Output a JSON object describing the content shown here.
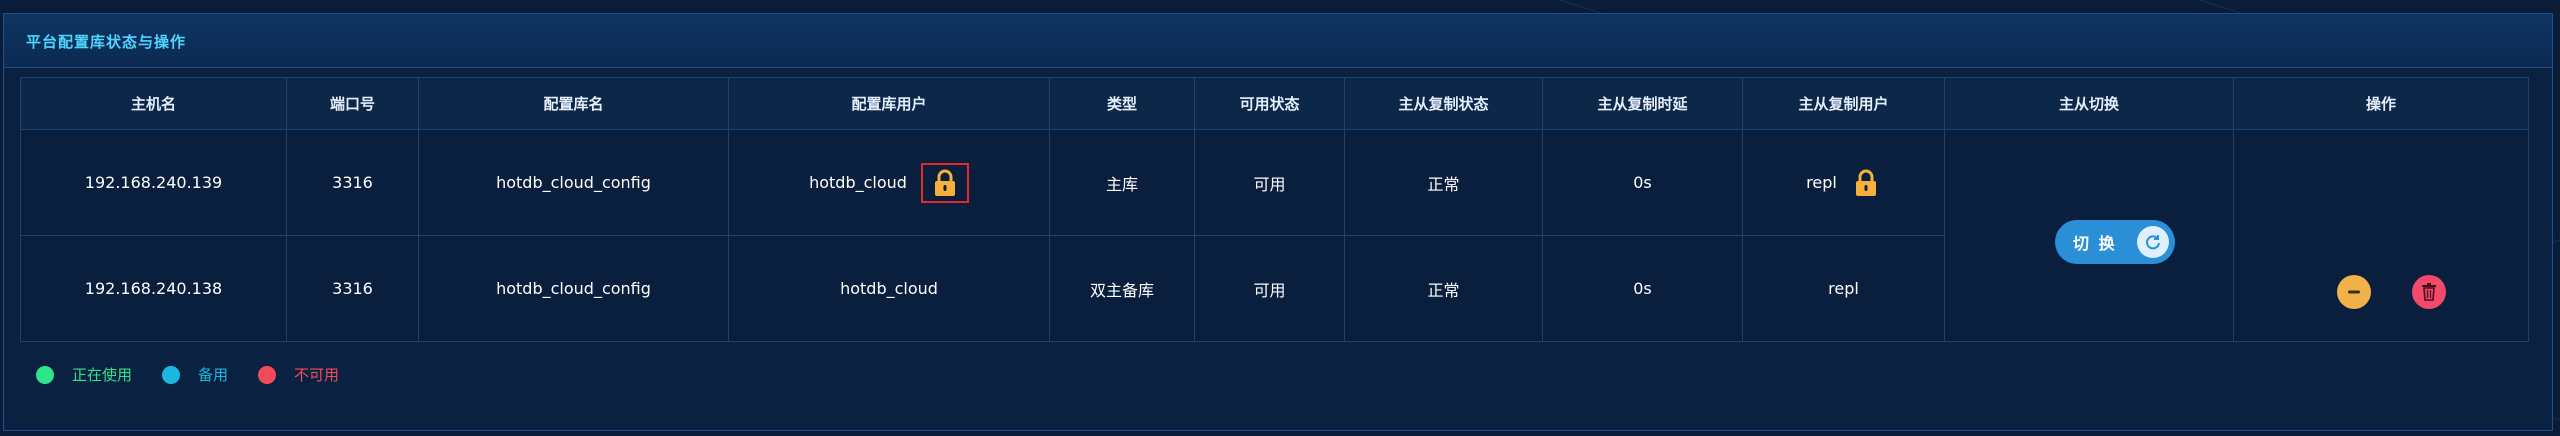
{
  "panel": {
    "title": "平台配置库状态与操作"
  },
  "table": {
    "headers": [
      "主机名",
      "端口号",
      "配置库名",
      "配置库用户",
      "类型",
      "可用状态",
      "主从复制状态",
      "主从复制时延",
      "主从复制用户",
      "主从切换",
      "操作"
    ],
    "rows": [
      {
        "host": "192.168.240.139",
        "port": "3316",
        "db": "hotdb_cloud_config",
        "user": "hotdb_cloud",
        "type": "主库",
        "status": "可用",
        "repl_status": "正常",
        "repl_delay": "0s",
        "repl_user": "repl"
      },
      {
        "host": "192.168.240.138",
        "port": "3316",
        "db": "hotdb_cloud_config",
        "user": "hotdb_cloud",
        "type": "双主备库",
        "status": "可用",
        "repl_status": "正常",
        "repl_delay": "0s",
        "repl_user": "repl"
      }
    ]
  },
  "switch": {
    "label": "切 换",
    "icon": "refresh-icon"
  },
  "actions": {
    "minus_icon": "minus-icon",
    "delete_icon": "trash-icon"
  },
  "legend": [
    {
      "label": "正在使用",
      "color": "#2ee58a"
    },
    {
      "label": "备用",
      "color": "#1ab8e0"
    },
    {
      "label": "不可用",
      "color": "#f24b5a"
    }
  ],
  "colors": {
    "lock": "#f5b13c",
    "available": "#2ee58a",
    "available_alt": "#21c7f0",
    "accent": "#4fd6ff"
  }
}
